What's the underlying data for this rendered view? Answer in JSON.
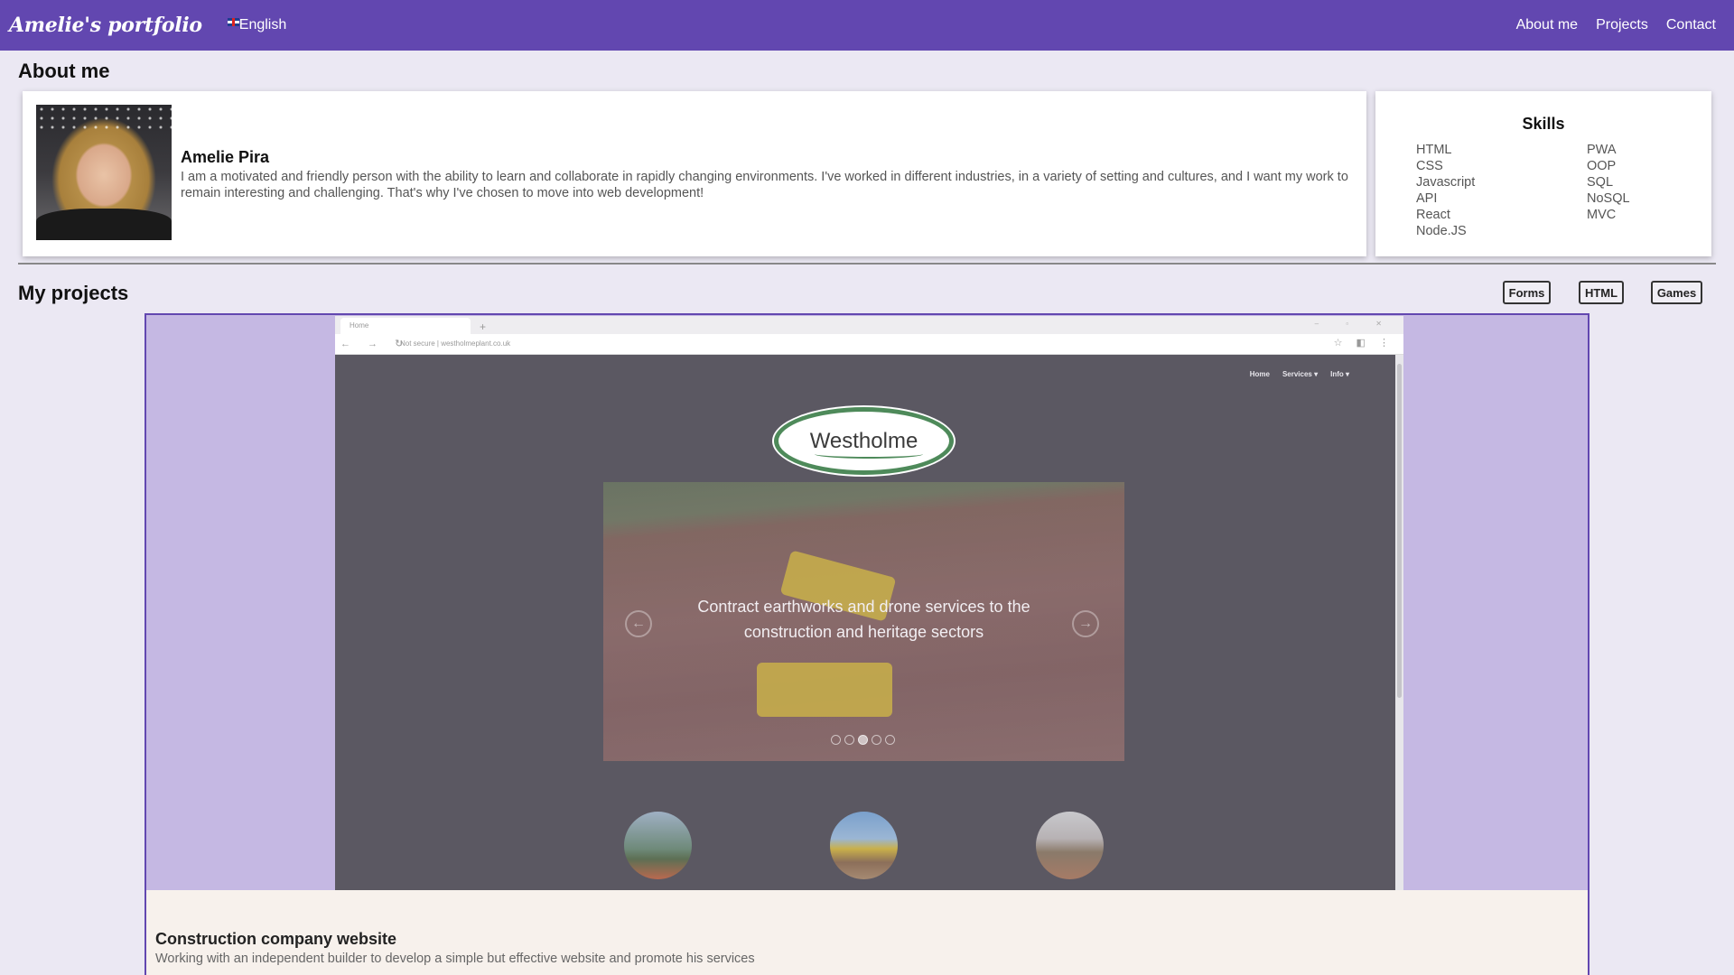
{
  "nav": {
    "brand": "Amelie's portfolio",
    "language": "English",
    "links": [
      "About me",
      "Projects",
      "Contact"
    ]
  },
  "about": {
    "heading": "About me",
    "name": "Amelie Pira",
    "description": "I am a motivated and friendly person with the ability to learn and collaborate in rapidly changing environments. I've worked in different industries, in a variety of setting and cultures, and I want my work to remain interesting and challenging. That's why I've chosen to move into web development!"
  },
  "skills": {
    "title": "Skills",
    "col1": [
      "HTML",
      "CSS",
      "Javascript",
      "API",
      "React",
      "Node.JS"
    ],
    "col2": [
      "PWA",
      "OOP",
      "SQL",
      "NoSQL",
      "MVC"
    ]
  },
  "projects": {
    "heading": "My projects",
    "filters": [
      "Forms",
      "HTML",
      "Games"
    ],
    "current": {
      "title": "Construction company website",
      "description": "Working with an independent builder to develop a simple but effective website and promote his services",
      "screenshot": {
        "tab_label": "Home",
        "url": "Not secure  |  westholmeplant.co.uk",
        "site_nav": [
          "Home",
          "Services ▾",
          "Info ▾"
        ],
        "logo_text": "Westholme",
        "caption_line1": "Contract earthworks and drone services to the",
        "caption_line2": "construction and heritage sectors"
      }
    }
  }
}
